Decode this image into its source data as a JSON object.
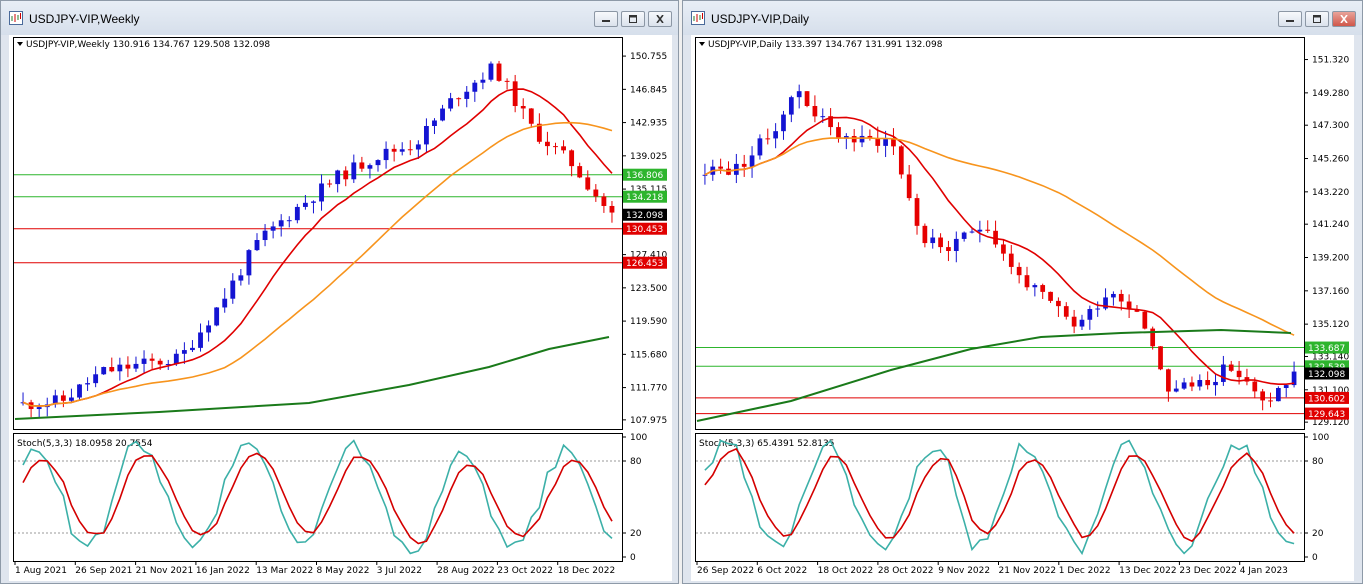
{
  "left": {
    "window_title": "USDJPY-VIP,Weekly",
    "header": "USDJPY-VIP,Weekly  130.916 134.767 129.508 132.098",
    "stoch_label": "Stoch(5,3,3) 18.0958 20.7554",
    "price_axis": [
      "150.755",
      "146.845",
      "142.935",
      "139.025",
      "135.115",
      "127.410",
      "123.500",
      "119.590",
      "115.680",
      "111.770",
      "107.975"
    ],
    "stoch_axis": [
      "100",
      "80",
      "20",
      "0"
    ],
    "date_axis": [
      "1 Aug 2021",
      "26 Sep 2021",
      "21 Nov 2021",
      "16 Jan 2022",
      "13 Mar 2022",
      "8 May 2022",
      "3 Jul 2022",
      "28 Aug 2022",
      "23 Oct 2022",
      "18 Dec 2022"
    ],
    "level_tags": [
      {
        "value": "136.806",
        "color": "#2db52d"
      },
      {
        "value": "134.218",
        "color": "#2db52d"
      },
      {
        "value": "132.098",
        "color": "#000000"
      },
      {
        "value": "130.453",
        "color": "#e00000"
      },
      {
        "value": "126.453",
        "color": "#e00000"
      }
    ]
  },
  "right": {
    "window_title": "USDJPY-VIP,Daily",
    "header": "USDJPY-VIP,Daily  133.397 134.767 131.991 132.098",
    "stoch_label": "Stoch(5,3,3) 65.4391 52.8135",
    "price_axis": [
      "151.320",
      "149.280",
      "147.300",
      "145.260",
      "143.220",
      "141.240",
      "139.200",
      "137.160",
      "135.120",
      "133.140",
      "131.100",
      "129.120"
    ],
    "stoch_axis": [
      "100",
      "80",
      "20",
      "0"
    ],
    "date_axis": [
      "26 Sep 2022",
      "6 Oct 2022",
      "18 Oct 2022",
      "28 Oct 2022",
      "9 Nov 2022",
      "21 Nov 2022",
      "1 Dec 2022",
      "13 Dec 2022",
      "23 Dec 2022",
      "4 Jan 2023"
    ],
    "level_tags": [
      {
        "value": "133.687",
        "color": "#2db52d"
      },
      {
        "value": "132.539",
        "color": "#2db52d"
      },
      {
        "value": "132.098",
        "color": "#000000"
      },
      {
        "value": "130.602",
        "color": "#e00000"
      },
      {
        "value": "129.643",
        "color": "#e00000"
      }
    ]
  },
  "colors": {
    "bull": "#1414d2",
    "bear": "#e60000",
    "ma_fast": "#e00000",
    "ma_mid": "#f7941d",
    "ma_slow": "#1a7a1a",
    "stoch_main": "#3cb0a8",
    "stoch_signal": "#d40000",
    "level_green": "#2db52d",
    "level_red": "#e00000"
  },
  "icons": [
    "chart-window-icon",
    "minimize-icon",
    "restore-icon",
    "close-icon"
  ]
}
